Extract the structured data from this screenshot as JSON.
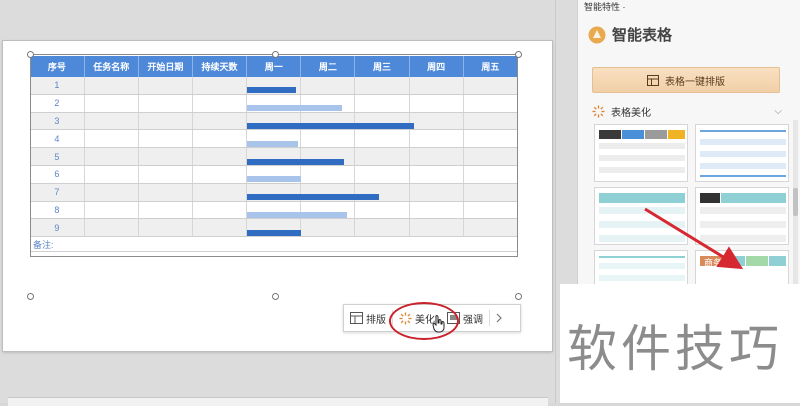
{
  "table": {
    "headers": [
      "序号",
      "任务名称",
      "开始日期",
      "持续天数",
      "周一",
      "周二",
      "周三",
      "周四",
      "周五"
    ],
    "rows": [
      "1",
      "2",
      "3",
      "4",
      "5",
      "6",
      "7",
      "8",
      "9"
    ],
    "note": "备注:",
    "bars": [
      0.18,
      0.35,
      0.62,
      0.19,
      0.36,
      0.2,
      0.49,
      0.37,
      0.2
    ],
    "bar_colors": [
      "#2f6cc2",
      "#a9c4ea"
    ]
  },
  "floatbar": {
    "layout": "排版",
    "beautify": "美化",
    "emphasize": "强调"
  },
  "panel": {
    "tab": "智能特性 ·",
    "title": "智能表格",
    "onekey": "表格一键排版",
    "section": "表格美化",
    "thumb_label": "商务"
  },
  "watermark": "软件技巧",
  "colors": {
    "header_blue": "#4d88d9",
    "accent_red": "#c9222b",
    "panel_gold": "#f1cfa7"
  },
  "icons": {
    "layout": "table-layout-icon",
    "beautify": "sparkle-icon",
    "emphasize": "highlight-icon",
    "next": "chevron-right-icon",
    "logo": "smart-table-logo-icon"
  }
}
